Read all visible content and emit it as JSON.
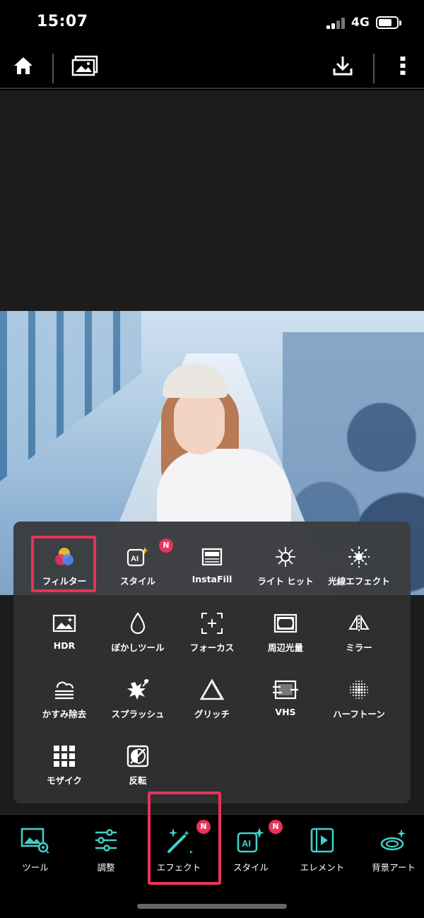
{
  "status_bar": {
    "time": "15:07",
    "network": "4G"
  },
  "top_toolbar": {
    "icons": [
      "home-icon",
      "gallery-icon",
      "download-icon",
      "more-vertical-icon"
    ]
  },
  "effect_panel": {
    "row1": [
      {
        "label": "フィルター",
        "icon": "filter-circles-icon",
        "highlighted": true
      },
      {
        "label": "スタイル",
        "icon": "ai-style-icon",
        "badge": "N"
      },
      {
        "label": "InstaFill",
        "icon": "instafill-icon"
      },
      {
        "label": "ライト ヒット",
        "icon": "light-hit-icon"
      },
      {
        "label": "光線エフェクト",
        "icon": "light-rays-icon"
      }
    ],
    "row2": [
      {
        "label": "HDR",
        "icon": "hdr-image-icon"
      },
      {
        "label": "ぼかしツール",
        "icon": "drop-icon"
      },
      {
        "label": "フォーカス",
        "icon": "focus-crosshair-icon"
      },
      {
        "label": "周辺光量",
        "icon": "vignette-icon"
      },
      {
        "label": "ミラー",
        "icon": "mirror-icon"
      }
    ],
    "row3": [
      {
        "label": "かすみ除去",
        "icon": "dehaze-icon"
      },
      {
        "label": "スプラッシュ",
        "icon": "splash-icon"
      },
      {
        "label": "グリッチ",
        "icon": "glitch-icon"
      },
      {
        "label": "VHS",
        "icon": "vhs-icon"
      },
      {
        "label": "ハーフトーン",
        "icon": "halftone-icon"
      }
    ],
    "row4": [
      {
        "label": "モザイク",
        "icon": "mosaic-icon"
      },
      {
        "label": "反転",
        "icon": "invert-icon"
      }
    ]
  },
  "bottom_nav": [
    {
      "label": "ツール",
      "icon": "tools-image-gear-icon"
    },
    {
      "label": "調整",
      "icon": "sliders-icon"
    },
    {
      "label": "エフェクト",
      "icon": "magic-wand-icon",
      "badge": "N",
      "highlighted": true,
      "active": true
    },
    {
      "label": "スタイル",
      "icon": "ai-sparkle-icon",
      "badge": "N"
    },
    {
      "label": "エレメント",
      "icon": "element-icon"
    },
    {
      "label": "背景アート",
      "icon": "background-art-icon"
    }
  ],
  "colors": {
    "accent_teal": "#3fd1c8",
    "highlight_red": "#e8335a",
    "panel_bg": "#303032"
  }
}
